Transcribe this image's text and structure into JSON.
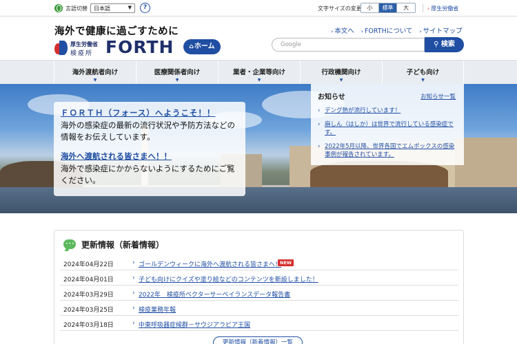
{
  "topbar": {
    "language_label": "言語切替",
    "language_selected": "日本語",
    "help_symbol": "?",
    "font_size_label": "文字サイズの変更",
    "font_sizes": [
      "小",
      "標準",
      "大"
    ],
    "font_size_active": "標準",
    "mhlw_link": "厚生労働省"
  },
  "header": {
    "tagline": "海外で健康に過ごすために",
    "logo_ministry": "厚生労働省",
    "logo_station": "検疫所",
    "logo_name": "FORTH",
    "home_label": "ホーム",
    "links": [
      "本文へ",
      "FORTHについて",
      "サイトマップ"
    ],
    "search_placeholder": "Google",
    "search_button": "検索"
  },
  "nav": {
    "items": [
      "海外渡航者向け",
      "医療関係者向け",
      "業者・企業等向け",
      "行政機関向け",
      "子ども向け"
    ]
  },
  "hero": {
    "welcome_title": "ＦＯＲＴＨ（フォース）へようこそ！！",
    "welcome_text": "海外の感染症の最新の流行状況や予防方法などの情報をお伝えしています。",
    "travel_title": "海外へ渡航される皆さまへ！！",
    "travel_text": "海外で感染症にかからないようにするためにご覧ください。"
  },
  "notice": {
    "title": "お知らせ",
    "all_link": "お知らせ一覧",
    "items": [
      "デング熱が流行しています！",
      "麻しん（はしか）は世界で流行している感染症です。",
      "2022年5月以降、世界各国でエムポックスの感染事例が報告されています。"
    ]
  },
  "news": {
    "title": "更新情報（新着情報）",
    "rows": [
      {
        "date": "2024年04月22日",
        "text": "ゴールデンウィークに海外へ渡航される皆さまへ！",
        "badge": "NEW"
      },
      {
        "date": "2024年04月01日",
        "text": "子ども向けにクイズや塗り絵などのコンテンツを新設しました！",
        "badge": ""
      },
      {
        "date": "2024年03月29日",
        "text": "2022年　検疫所ベクターサーベイランスデータ報告書",
        "badge": ""
      },
      {
        "date": "2024年03月25日",
        "text": "検疫業務年報",
        "badge": ""
      },
      {
        "date": "2024年03月18日",
        "text": "中東呼吸器症候群－サウジアラビア王国",
        "badge": ""
      }
    ],
    "more_label": "更新情報（新着情報）一覧"
  },
  "colors": {
    "brand_blue": "#1f4ea3",
    "brand_red": "#d52e2e",
    "nav_bg": "#e9ecf0"
  },
  "icons": {
    "language": "globe-icon",
    "help": "help-icon",
    "search": "search-icon",
    "home": "home-icon",
    "news": "chat-bubble-icon"
  }
}
